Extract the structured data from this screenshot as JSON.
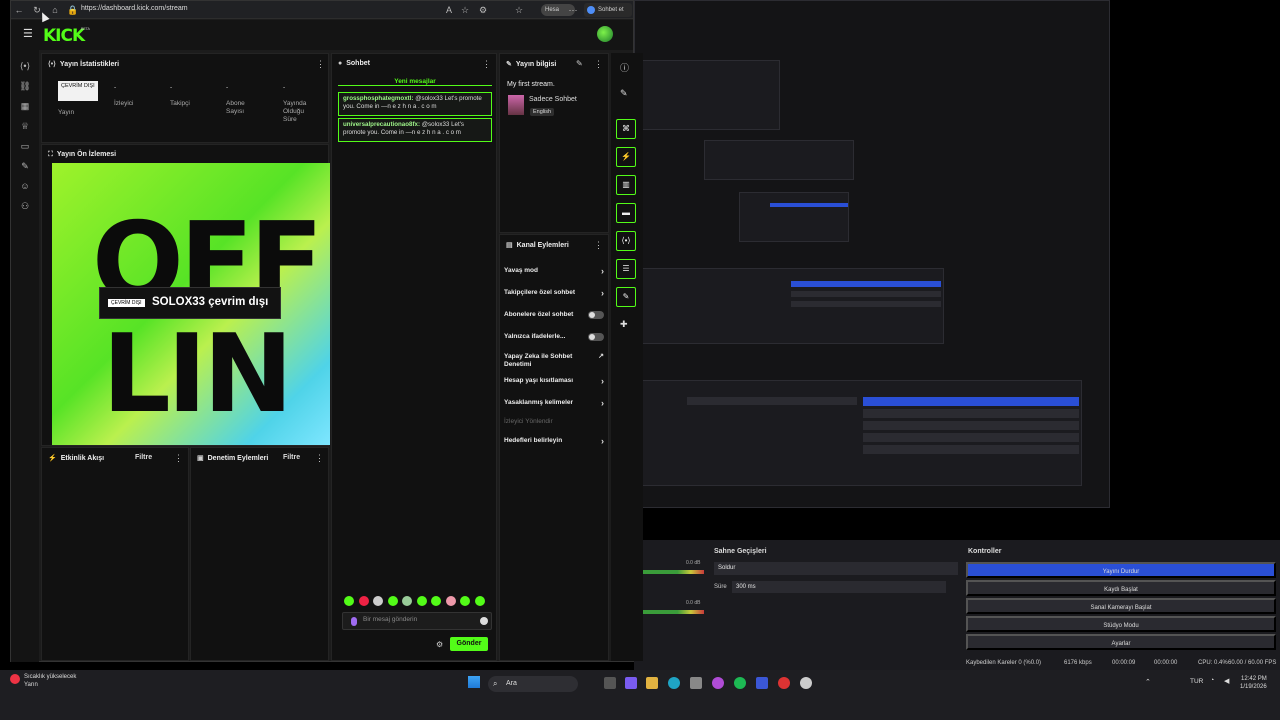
{
  "browser": {
    "url": "https://dashboard.kick.com/stream",
    "profile_label": "Hesa",
    "sohbet_button": "Sohbet et"
  },
  "kick": {
    "logo": "KICK",
    "logo_beta": "BETA"
  },
  "stats": {
    "title": "Yayın İstatistikleri",
    "offline_badge": "ÇEVRİM DIŞI",
    "yayin_label": "Yayın",
    "items": [
      {
        "value": "-",
        "label": "İzleyici"
      },
      {
        "value": "-",
        "label": "Takipçi"
      },
      {
        "value": "-",
        "label": "Abone Sayısı"
      },
      {
        "value": "-",
        "label": "Yayında Olduğu Süre"
      }
    ]
  },
  "preview": {
    "title": "Yayın Ön İzlemesi",
    "letters_top": "OFF",
    "letters_bottom": "LIN",
    "offline_tag": "ÇEVRİM DIŞI",
    "offline_text": "SOLOX33 çevrim dışı"
  },
  "activity": {
    "title": "Etkinlik Akışı",
    "filter": "Filtre"
  },
  "moderation": {
    "title": "Denetim Eylemleri",
    "filter": "Filtre"
  },
  "chat": {
    "title": "Sohbet",
    "new_messages": "Yeni mesajlar",
    "messages": [
      {
        "user": "grossphosphategmoxtl:",
        "text": "@solox33 Let's promote you. Come in —n e z h n a . c o m"
      },
      {
        "user": "universalprecautionao8fx:",
        "text": "@solox33 Let's promote you. Come in —n e z h n a . c o m"
      }
    ],
    "input_placeholder": "Bir mesaj gönderin",
    "send_label": "Gönder"
  },
  "stream_info": {
    "title": "Yayın bilgisi",
    "stream_title": "My first stream.",
    "category": "Sadece Sohbet",
    "language": "English"
  },
  "channel_actions": {
    "title": "Kanal Eylemleri",
    "items": [
      {
        "label": "Yavaş mod",
        "control": "chevron"
      },
      {
        "label": "Takipçilere özel sohbet",
        "control": "chevron"
      },
      {
        "label": "Abonelere özel sohbet",
        "control": "toggle",
        "on": false
      },
      {
        "label": "Yalnızca ifadelerle...",
        "control": "toggle",
        "on": false
      },
      {
        "label": "Yapay Zeka ile Sohbet Denetimi",
        "control": "external"
      },
      {
        "label": "Hesap yaşı kısıtlaması",
        "control": "chevron"
      },
      {
        "label": "Yasaklanmış kelimeler",
        "control": "chevron"
      },
      {
        "label": "İzleyici Yönlendir",
        "control": "none",
        "disabled": true
      },
      {
        "label": "Hedefleri belirleyin",
        "control": "chevron"
      }
    ]
  },
  "obs": {
    "scene_transitions": "Sahne Geçişleri",
    "controls": "Kontroller",
    "transition": "Soldur",
    "duration_label": "Süre",
    "duration_value": "300 ms",
    "db1": "0.0 dB",
    "db2": "0.0 dB",
    "buttons": [
      "Yayını Durdur",
      "Kaydı Başlat",
      "Sanal Kamerayı Başlat",
      "Stüdyo Modu",
      "Ayarlar"
    ],
    "status": {
      "dropped": "Kaybedilen Kareler 0 (%0.0)",
      "bitrate": "6176 kbps",
      "rec_time": "00:00:09",
      "stream_time": "00:00:00",
      "cpu": "CPU: 0.4%",
      "fps": "60.00 / 60.00 FPS"
    }
  },
  "taskbar": {
    "search": "Ara",
    "weather_line1": "Sıcaklık yükselecek",
    "weather_line2": "Yarın",
    "lang": "TUR",
    "time": "12:42 PM",
    "date": "1/19/2026"
  },
  "colors": {
    "accent": "#53fc18",
    "obs_blue": "#2a4fd6"
  }
}
